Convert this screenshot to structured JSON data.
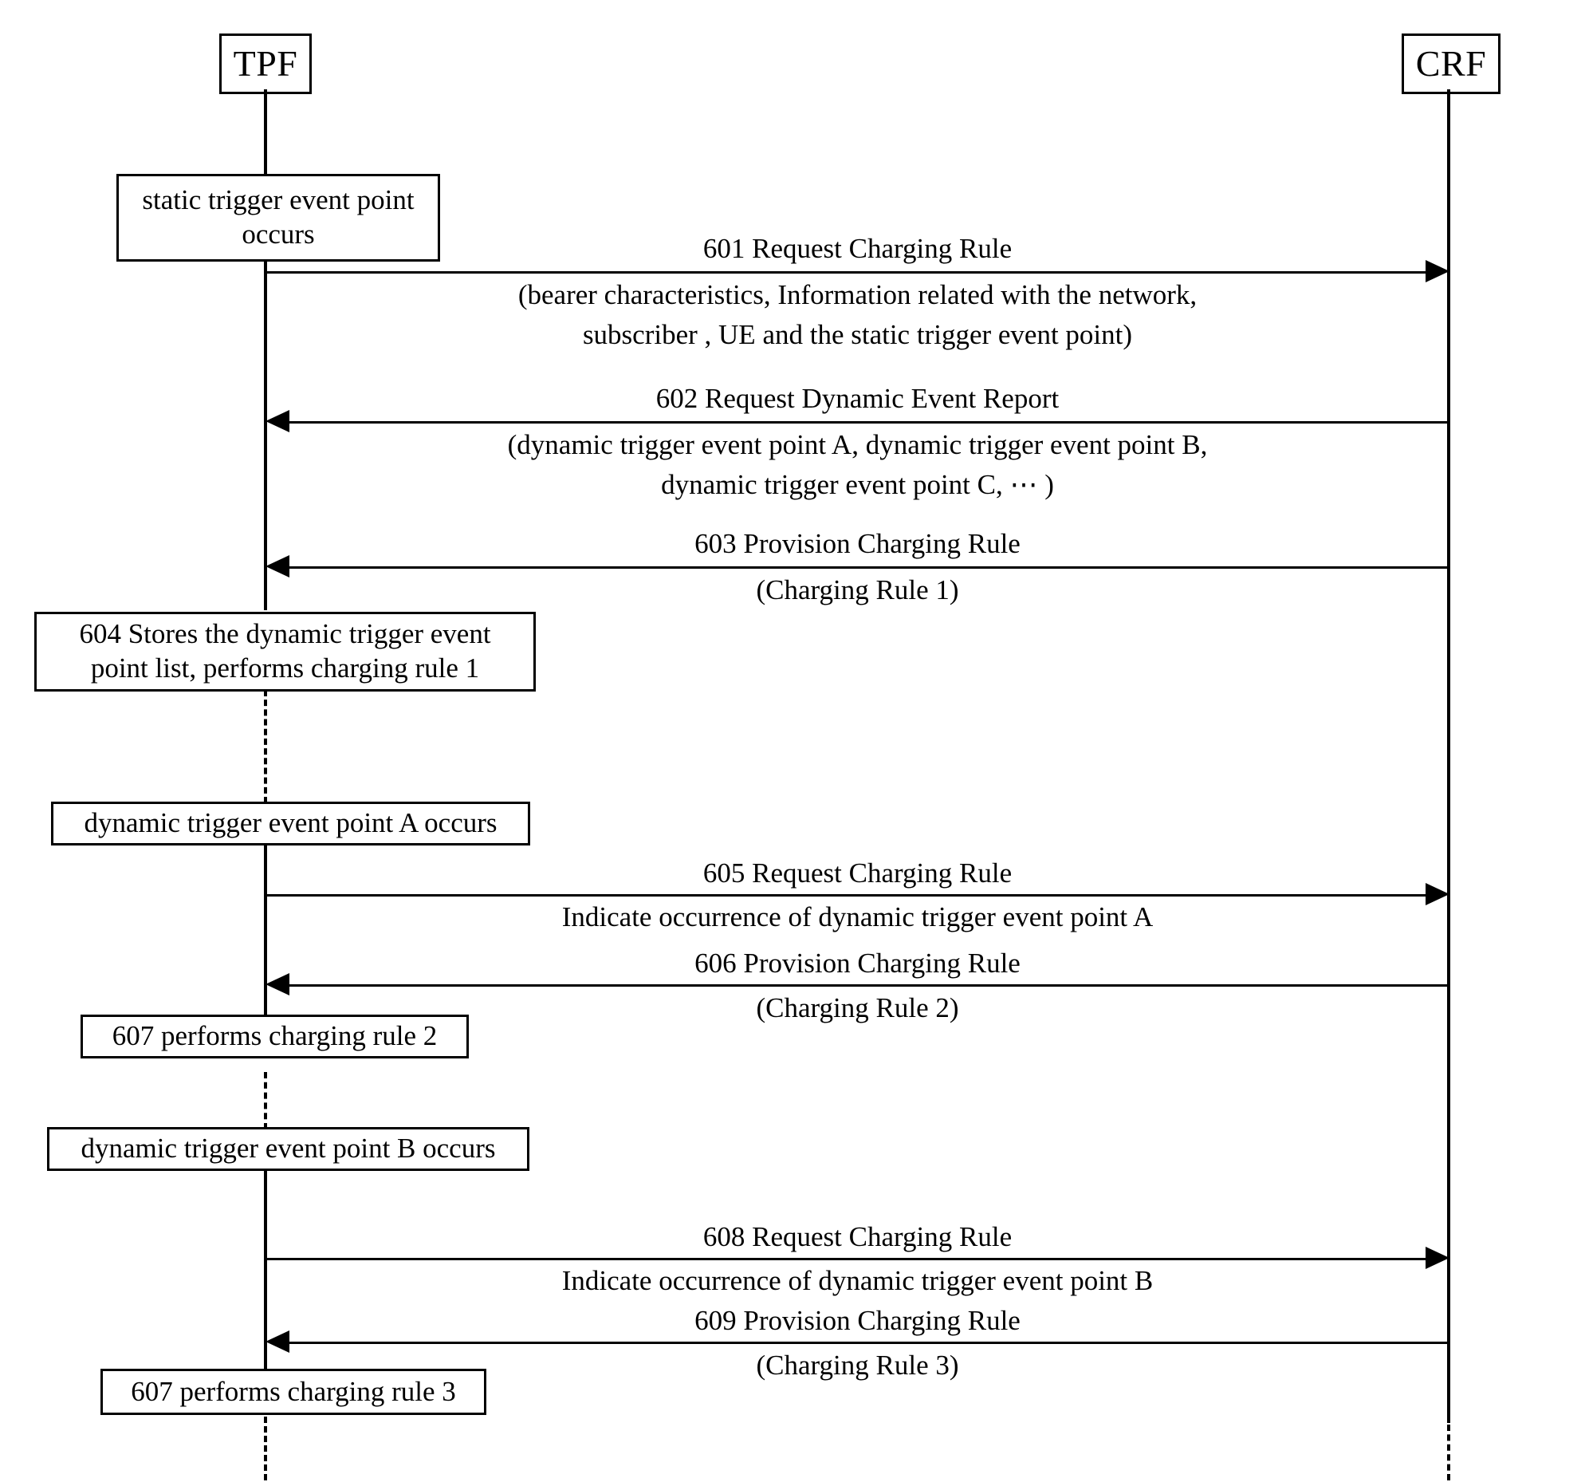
{
  "diagram": {
    "type": "sequence-diagram",
    "actors": [
      {
        "id": "tpf",
        "label": "TPF"
      },
      {
        "id": "crf",
        "label": "CRF"
      }
    ],
    "notes": [
      {
        "id": "note-static-trigger",
        "lines": [
          "static trigger event point",
          "occurs"
        ]
      },
      {
        "id": "note-604",
        "lines": [
          "604  Stores the dynamic trigger event",
          "point list, performs charging rule 1"
        ]
      },
      {
        "id": "note-event-a",
        "lines": [
          "dynamic trigger event point A occurs"
        ]
      },
      {
        "id": "note-607-rule2",
        "lines": [
          "607 performs charging rule 2"
        ]
      },
      {
        "id": "note-event-b",
        "lines": [
          "dynamic trigger event point B occurs"
        ]
      },
      {
        "id": "note-607-rule3",
        "lines": [
          "607 performs charging rule 3"
        ]
      }
    ],
    "messages": [
      {
        "id": "msg-601",
        "number": "601",
        "title": "Request Charging Rule",
        "direction": "right",
        "from": "TPF",
        "to": "CRF",
        "detail_lines": [
          "(bearer characteristics, Information related with the network,",
          "subscriber , UE and the static trigger event point)"
        ]
      },
      {
        "id": "msg-602",
        "number": "602",
        "title": "Request Dynamic Event Report",
        "direction": "left",
        "from": "CRF",
        "to": "TPF",
        "detail_lines": [
          "(dynamic trigger event point A, dynamic trigger event point B,",
          "dynamic trigger event point C, ⋯ )"
        ]
      },
      {
        "id": "msg-603",
        "number": "603",
        "title": "Provision Charging Rule",
        "direction": "left",
        "from": "CRF",
        "to": "TPF",
        "detail_lines": [
          "(Charging Rule 1)"
        ]
      },
      {
        "id": "msg-605",
        "number": "605",
        "title": "Request Charging Rule",
        "direction": "right",
        "from": "TPF",
        "to": "CRF",
        "detail_lines": [
          "Indicate occurrence of dynamic trigger event point A"
        ]
      },
      {
        "id": "msg-606",
        "number": "606",
        "title": "Provision Charging Rule",
        "direction": "left",
        "from": "CRF",
        "to": "TPF",
        "detail_lines": [
          "(Charging Rule 2)"
        ]
      },
      {
        "id": "msg-608",
        "number": "608",
        "title": "Request Charging Rule",
        "direction": "right",
        "from": "TPF",
        "to": "CRF",
        "detail_lines": [
          "Indicate occurrence of dynamic trigger event point B"
        ]
      },
      {
        "id": "msg-609",
        "number": "609",
        "title": "Provision Charging Rule",
        "direction": "left",
        "from": "CRF",
        "to": "TPF",
        "detail_lines": [
          "(Charging Rule 3)"
        ]
      }
    ],
    "labels": {
      "msg601_title": "601    Request Charging Rule",
      "msg601_detail1": "(bearer characteristics, Information related with the network,",
      "msg601_detail2": "subscriber , UE and the static trigger event point)",
      "msg602_title": "602    Request Dynamic Event Report",
      "msg602_detail1": "(dynamic trigger event point A, dynamic trigger event point B,",
      "msg602_detail2": "dynamic trigger event point C, ⋯ )",
      "msg603_title": "603    Provision Charging Rule",
      "msg603_detail1": "(Charging Rule 1)",
      "msg605_title": "605   Request Charging Rule",
      "msg605_detail1": "Indicate occurrence of dynamic trigger event point A",
      "msg606_title": "606  Provision Charging Rule",
      "msg606_detail1": "(Charging Rule 2)",
      "msg608_title": "608    Request Charging Rule",
      "msg608_detail1": "Indicate occurrence of dynamic trigger event point B",
      "msg609_title": "609  Provision Charging Rule",
      "msg609_detail1": "(Charging Rule 3)",
      "note_static_l1": "static trigger event point",
      "note_static_l2": "occurs",
      "note_604_l1": "604  Stores the dynamic trigger event",
      "note_604_l2": "point list, performs charging rule 1",
      "note_event_a": "dynamic trigger event point A occurs",
      "note_607_rule2": "607 performs charging rule 2",
      "note_event_b": "dynamic trigger event point B occurs",
      "note_607_rule3": "607 performs charging rule 3",
      "actor_tpf": "TPF",
      "actor_crf": "CRF"
    },
    "colors": {
      "stroke": "#000000",
      "background": "#ffffff"
    }
  }
}
